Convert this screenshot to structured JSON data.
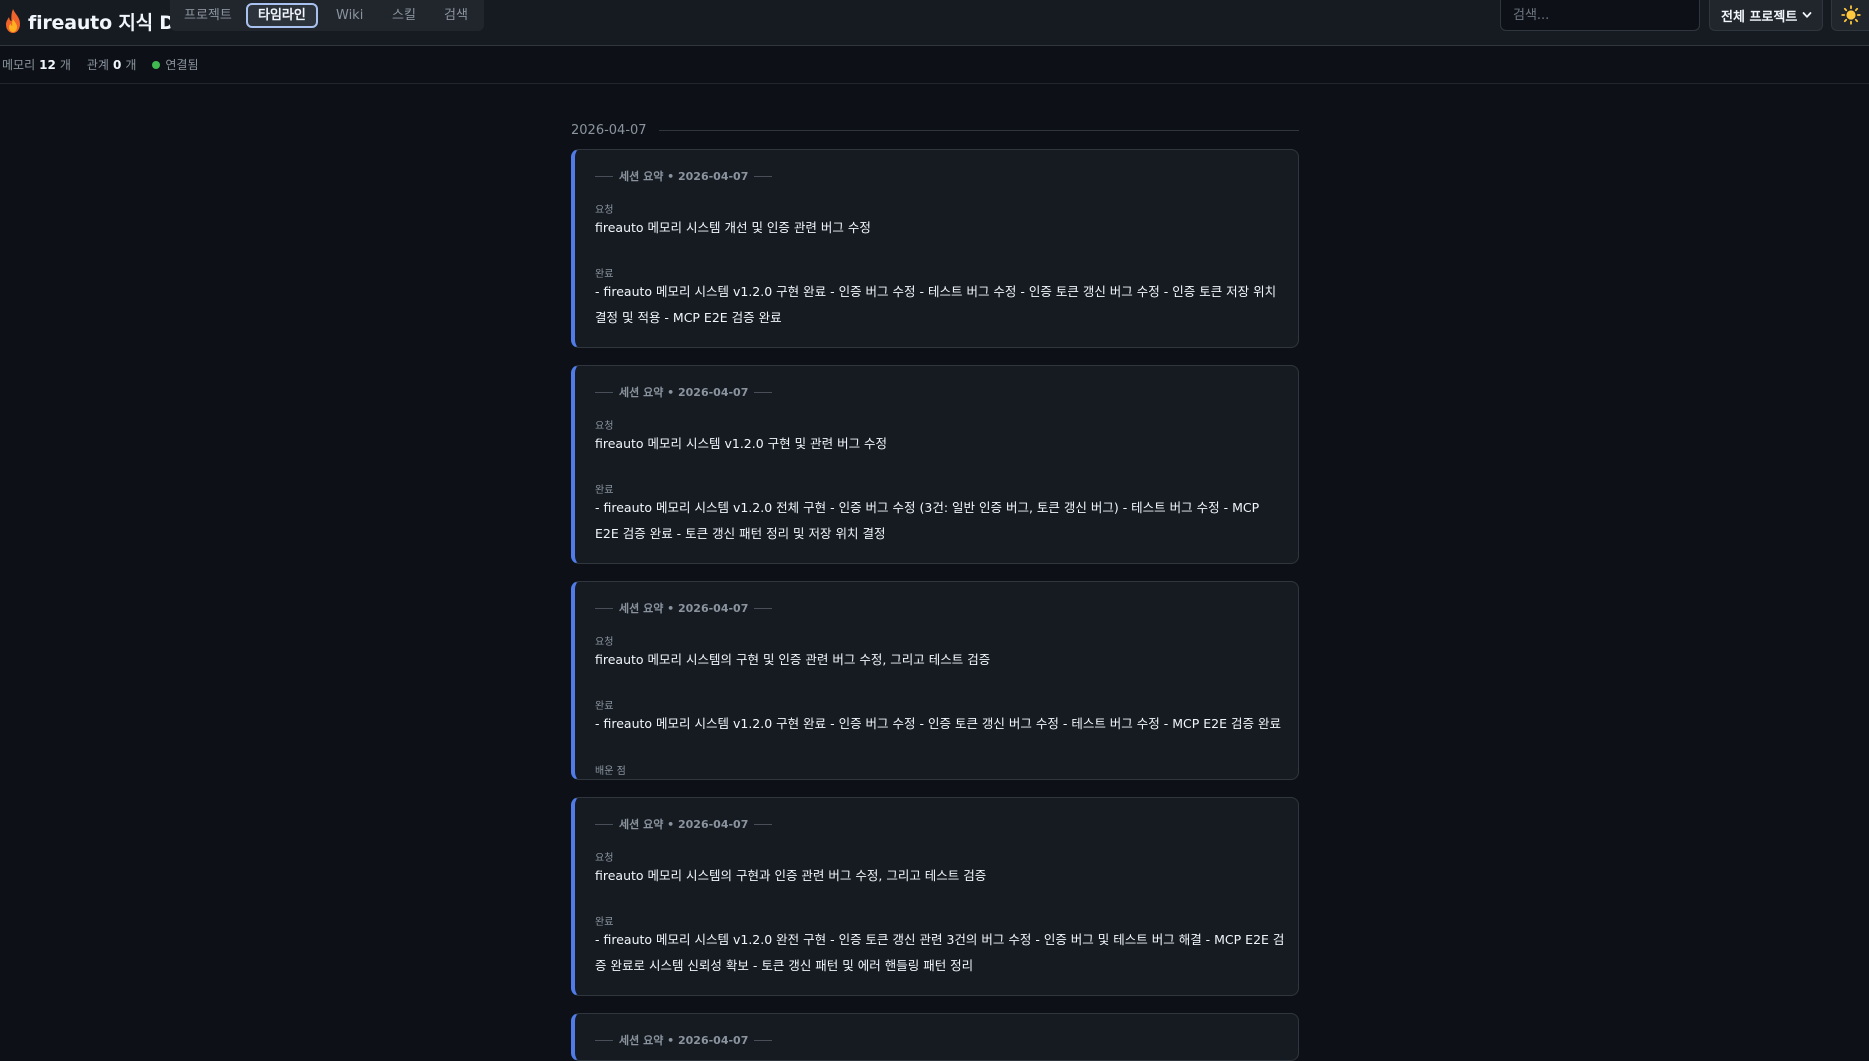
{
  "app": {
    "title": "fireauto 지식 DB",
    "logo_icon": "fire-icon"
  },
  "nav": {
    "tabs": [
      {
        "label": "프로젝트",
        "active": false
      },
      {
        "label": "타임라인",
        "active": true
      },
      {
        "label": "Wiki",
        "active": false
      },
      {
        "label": "스킬",
        "active": false
      },
      {
        "label": "검색",
        "active": false
      }
    ]
  },
  "search": {
    "placeholder": "검색...",
    "value": ""
  },
  "project_filter": {
    "selected": "전체 프로젝트"
  },
  "theme_toggle": {
    "icon": "sun-icon"
  },
  "status": {
    "memory_label": "메모리",
    "memory_count": "12",
    "memory_unit": "개",
    "relation_label": "관계",
    "relation_count": "0",
    "relation_unit": "개",
    "connection": "연결됨",
    "connection_color": "#3fb950"
  },
  "timeline": {
    "date_group": "2026-04-07",
    "accent_color": "#4f7ce8",
    "cards": [
      {
        "header": "세션 요약 • 2026-04-07",
        "request_label": "요청",
        "request": "fireauto 메모리 시스템 개선 및 인증 관련 버그 수정",
        "done_label": "완료",
        "done": "- fireauto 메모리 시스템 v1.2.0 구현 완료 - 인증 버그 수정 - 테스트 버그 수정 - 인증 토큰 갱신 버그 수정 - 인증 토큰 저장 위치 결정 및 적용 - MCP E2E 검증 완료"
      },
      {
        "header": "세션 요약 • 2026-04-07",
        "request_label": "요청",
        "request": "fireauto 메모리 시스템 v1.2.0 구현 및 관련 버그 수정",
        "done_label": "완료",
        "done": "- fireauto 메모리 시스템 v1.2.0 전체 구현 - 인증 버그 수정 (3건: 일반 인증 버그, 토큰 갱신 버그) - 테스트 버그 수정 - MCP E2E 검증 완료 - 토큰 갱신 패턴 정리 및 저장 위치 결정"
      },
      {
        "header": "세션 요약 • 2026-04-07",
        "request_label": "요청",
        "request": "fireauto 메모리 시스템의 구현 및 인증 관련 버그 수정, 그리고 테스트 검증",
        "done_label": "완료",
        "done": "- fireauto 메모리 시스템 v1.2.0 구현 완료 - 인증 버그 수정 - 인증 토큰 갱신 버그 수정 - 테스트 버그 수정 - MCP E2E 검증 완료",
        "learned_label": "배운 점"
      },
      {
        "header": "세션 요약 • 2026-04-07",
        "request_label": "요청",
        "request": "fireauto 메모리 시스템의 구현과 인증 관련 버그 수정, 그리고 테스트 검증",
        "done_label": "완료",
        "done": "- fireauto 메모리 시스템 v1.2.0 완전 구현 - 인증 토큰 갱신 관련 3건의 버그 수정 - 인증 버그 및 테스트 버그 해결 - MCP E2E 검증 완료로 시스템 신뢰성 확보 - 토큰 갱신 패턴 및 에러 핸들링 패턴 정리"
      },
      {
        "header": "세션 요약 • 2026-04-07"
      }
    ]
  }
}
